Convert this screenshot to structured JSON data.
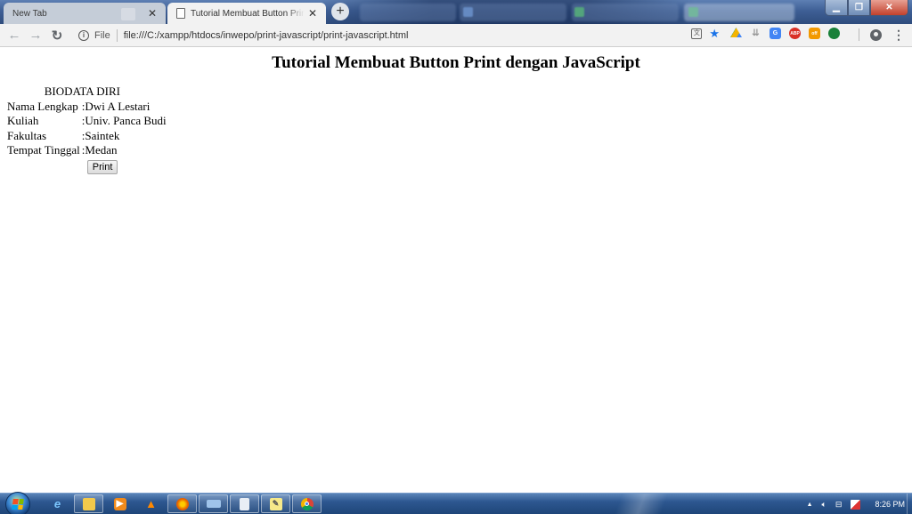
{
  "browser": {
    "tabs": [
      {
        "label": "New Tab",
        "active": false
      },
      {
        "label": "Tutorial Membuat Button Print dengan JavaScript",
        "active": true
      }
    ],
    "new_tab_label": "+",
    "close_glyph": "✕",
    "address": {
      "scheme_label": "File",
      "url": "file:///C:/xampp/htdocs/inwepo/print-javascript/print-javascript.html"
    },
    "extensions": [
      "google-drive-icon",
      "pocket-icon",
      "google-translate-icon",
      "adblock-icon",
      "extension-off-icon",
      "extension-green-icon"
    ],
    "accent_color": "#1a73e8"
  },
  "page": {
    "title": "Tutorial Membuat Button Print dengan JavaScript",
    "biodata": {
      "caption": "BIODATA DIRI",
      "rows": [
        {
          "label": "Nama Lengkap",
          "separator": ":",
          "value": "Dwi A Lestari"
        },
        {
          "label": "Kuliah",
          "separator": ":",
          "value": "Univ. Panca Budi"
        },
        {
          "label": "Fakultas",
          "separator": ":",
          "value": "Saintek"
        },
        {
          "label": "Tempat Tinggal",
          "separator": ":",
          "value": "Medan"
        }
      ],
      "print_button": "Print"
    }
  },
  "taskbar": {
    "clock": "8:26 PM",
    "pinned": [
      "internet-explorer-icon",
      "file-explorer-icon",
      "media-player-icon",
      "vlc-icon",
      "firefox-icon",
      "keyboard-icon",
      "notepad-icon",
      "sticky-notes-icon",
      "chrome-icon"
    ]
  }
}
